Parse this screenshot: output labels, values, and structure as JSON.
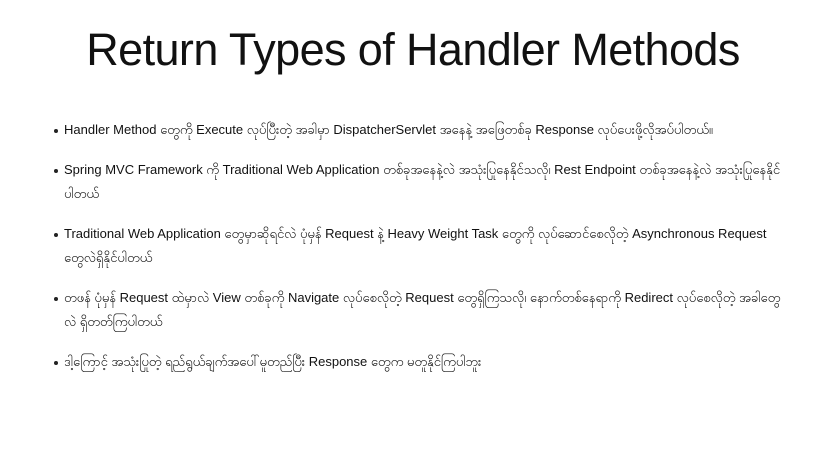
{
  "slide": {
    "title": "Return Types of Handler Methods",
    "bullets": [
      "Handler Method တွေကို Execute လုပ်ပြီးတဲ့ အခါမှာ DispatcherServlet အနေနဲ့ အဖြေတစ်ခု Response လုပ်ပေးဖို့လိုအပ်ပါတယ်။",
      "Spring MVC Framework ကို Traditional Web Application တစ်ခုအနေနဲ့လဲ အသုံးပြုနေနိုင်သလို၊ Rest Endpoint တစ်ခုအနေနဲ့လဲ အသုံးပြုနေနိုင်ပါတယ်",
      "Traditional Web Application တွေမှာဆိုရင်လဲ ပုံမှန် Request နဲ့ Heavy Weight Task တွေကို လုပ်ဆောင်စေလိုတဲ့ Asynchronous Request တွေလဲရှိနိုင်ပါတယ်",
      "တဖန် ပုံမှန် Request ထဲမှာလဲ View တစ်ခုကို Navigate လုပ်စေလိုတဲ့ Request တွေရှိကြသလို၊ နောက်တစ်နေရာကို Redirect လုပ်စေလိုတဲ့ အခါတွေလဲ ရှိတတ်ကြပါတယ်",
      "ဒါ့ကြောင့် အသုံးပြုတဲ့ ရည်ရွယ်ချက်အပေါ်မူတည်ပြီး Response တွေက မတူနိုင်ကြပါဘူး"
    ]
  }
}
